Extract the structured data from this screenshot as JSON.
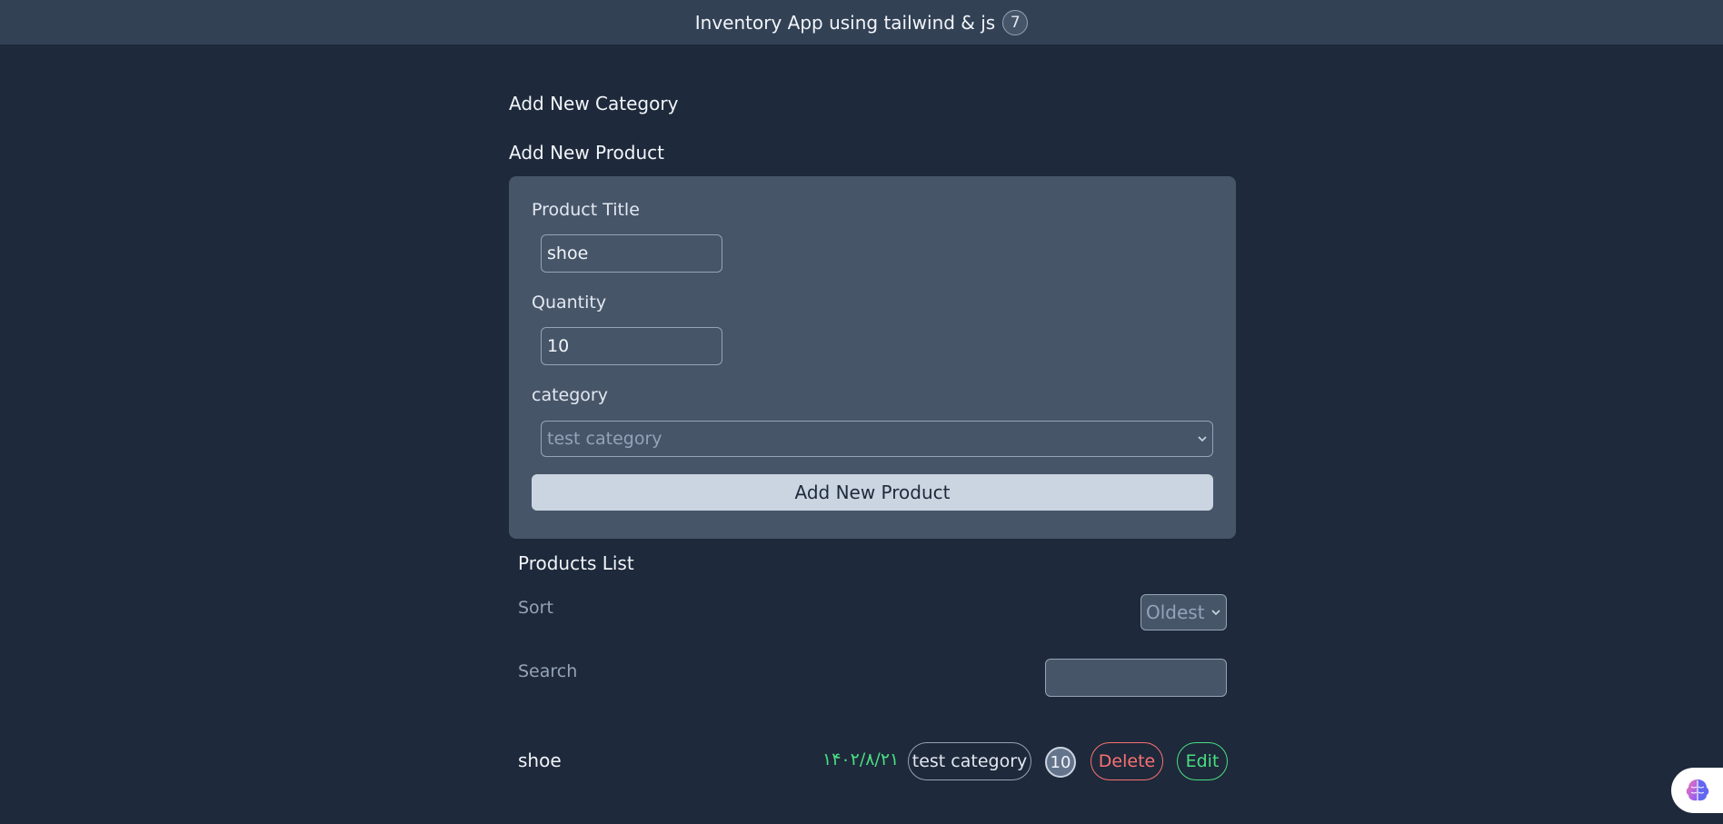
{
  "header": {
    "title": "Inventory App using tailwind & js",
    "count": "7"
  },
  "sections": {
    "add_category": "Add New Category",
    "add_product": "Add New Product"
  },
  "product_form": {
    "title_label": "Product Title",
    "title_value": "shoe",
    "quantity_label": "Quantity",
    "quantity_value": "10",
    "category_label": "category",
    "category_selected": "test category",
    "submit_label": "Add New Product"
  },
  "products_list": {
    "title": "Products List",
    "sort_label": "Sort",
    "sort_selected": "Oldest",
    "search_label": "Search",
    "search_value": "",
    "items": [
      {
        "title": "shoe",
        "date": "۱۴۰۲/۸/۲۱",
        "category": "test category",
        "quantity": "10",
        "delete_label": "Delete",
        "edit_label": "Edit"
      }
    ]
  },
  "icons": {
    "chevron": "chevron-down-icon",
    "corner_widget": "brain-icon"
  },
  "colors": {
    "background": "#1e293b",
    "topbar": "#334155",
    "panel": "#475569",
    "date_green": "#4ade80",
    "delete_red": "#f87171"
  }
}
